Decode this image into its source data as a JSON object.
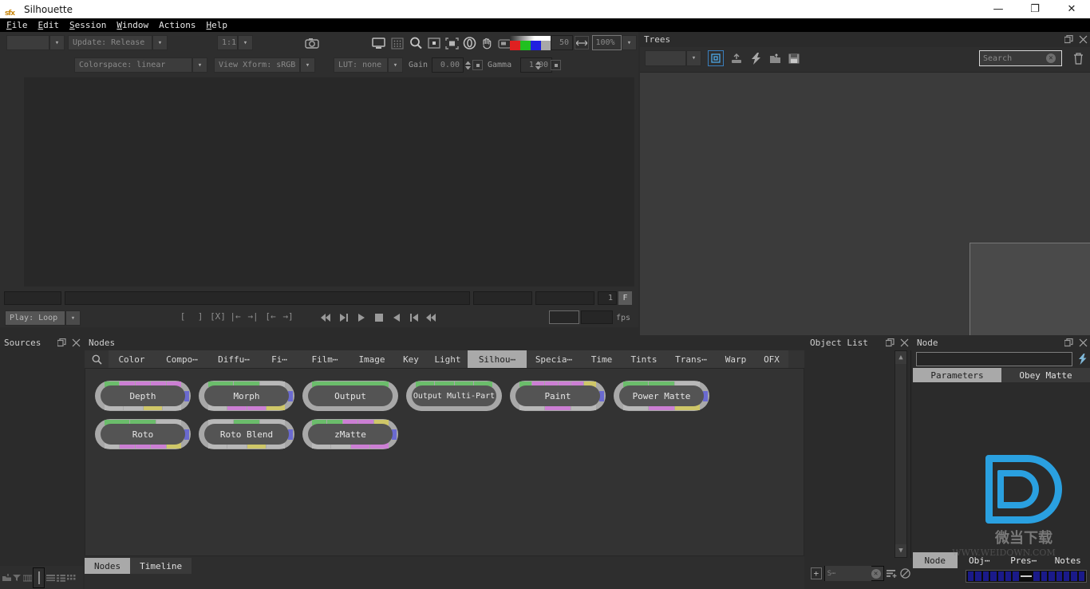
{
  "window": {
    "title": "Silhouette",
    "logo_icon": "sfx-logo-icon",
    "minimize_label": "—",
    "maximize_label": "❐",
    "close_label": "✕"
  },
  "menubar": {
    "items": [
      {
        "label": "File",
        "mnemonic": "F"
      },
      {
        "label": "Edit",
        "mnemonic": "E"
      },
      {
        "label": "Session",
        "mnemonic": "S"
      },
      {
        "label": "Window",
        "mnemonic": "W"
      },
      {
        "label": "Actions",
        "mnemonic": "A"
      },
      {
        "label": "Help",
        "mnemonic": "H"
      }
    ]
  },
  "toolbar": {
    "session_combo": "",
    "update_combo": "Update: Release",
    "ratio_combo": "1:1",
    "snapshot_icon": "camera-icon",
    "view_icons": [
      "monitor-icon",
      "grid-icon",
      "magnifier-icon",
      "frame-icon",
      "fit-icon",
      "color-wheel-icon",
      "hand-icon",
      "region-icon"
    ],
    "channel_swatch_icon": "rgba-channel-swatch",
    "brightness_value": "50",
    "fit_width_icon": "fit-width-icon",
    "zoom_value": "100%",
    "colorspace_combo": "Colorspace: linear",
    "view_xform_combo": "View Xform: sRGB",
    "lut_combo": "LUT: none",
    "gain_label": "Gain",
    "gain_value": "0.00",
    "gamma_label": "Gamma",
    "gamma_value": "1.00"
  },
  "transport": {
    "in_field": "",
    "scrub_field": "",
    "range_field_a": "",
    "range_field_b": "",
    "frame_value": "1",
    "frame_unit": "F",
    "play_mode_combo": "Play: Loop",
    "marker_buttons": [
      "[",
      "]",
      "[X]",
      "|←",
      "→|",
      "[←",
      "→]"
    ],
    "playback_icons": [
      "rewind-icon",
      "step-back-icon",
      "play-back-icon",
      "stop-icon",
      "play-forward-icon",
      "step-forward-icon",
      "fast-forward-icon"
    ],
    "fps_field_a": "",
    "fps_field_b": "",
    "fps_label": "fps"
  },
  "trees": {
    "title": "Trees",
    "float_icon": "float-panel-icon",
    "close_icon": "close-icon",
    "tree_combo": "",
    "tools": [
      {
        "icon": "new-tree-icon",
        "active": true
      },
      {
        "icon": "import-icon",
        "active": false
      },
      {
        "icon": "lightning-icon",
        "active": false
      },
      {
        "icon": "open-folder-icon",
        "active": false
      },
      {
        "icon": "save-icon",
        "active": false
      }
    ],
    "search_placeholder": "Search",
    "search_clear_icon": "clear-icon",
    "trash_icon": "trash-icon"
  },
  "sources": {
    "title": "Sources",
    "float_icon": "float-panel-icon",
    "close_icon": "close-icon",
    "footer_icons": [
      "add-source-icon",
      "filter-icon",
      "columns-icon",
      "separator-handle",
      "list-view-icon",
      "detail-view-icon",
      "thumb-view-icon"
    ]
  },
  "nodes": {
    "title": "Nodes",
    "search_icon": "search-icon",
    "tabs": [
      {
        "label": "Color",
        "active": false
      },
      {
        "label": "Compo⋯",
        "active": false
      },
      {
        "label": "Diffu⋯",
        "active": false
      },
      {
        "label": "Fi⋯",
        "active": false
      },
      {
        "label": "Film⋯",
        "active": false
      },
      {
        "label": "Image",
        "active": false
      },
      {
        "label": "Key",
        "active": false
      },
      {
        "label": "Light",
        "active": false
      },
      {
        "label": "Silhou⋯",
        "active": true
      },
      {
        "label": "Specia⋯",
        "active": false
      },
      {
        "label": "Time",
        "active": false
      },
      {
        "label": "Tints",
        "active": false
      },
      {
        "label": "Trans⋯",
        "active": false
      },
      {
        "label": "Warp",
        "active": false
      },
      {
        "label": "OFX",
        "active": false
      }
    ],
    "items": [
      {
        "label": "Depth",
        "top_ports": [
          "#6bbd6b",
          "#cc7fd4",
          "#cc7fd4",
          "#cc7fd4",
          "#cc7fd4"
        ],
        "bot_ports": [
          "#b8b8b8",
          "#b8b8b8",
          "#cfc768",
          "#b8b8b8"
        ],
        "out_port": "#6a6ad0"
      },
      {
        "label": "Morph",
        "top_ports": [
          "#6bbd6b",
          "#6bbd6b",
          "#b8b8b8"
        ],
        "bot_ports": [
          "#b8b8b8",
          "#cc7fd4",
          "#cc7fd4",
          "#cfc768"
        ],
        "out_port": "#6a6ad0"
      },
      {
        "label": "Output",
        "top_ports": [
          "#6bbd6b"
        ],
        "bot_ports": [],
        "out_port": ""
      },
      {
        "label": "Output Multi-Part",
        "top_ports": [
          "#6bbd6b",
          "#6bbd6b",
          "#6bbd6b",
          "#6bbd6b"
        ],
        "bot_ports": [],
        "out_port": ""
      },
      {
        "label": "Paint",
        "top_ports": [
          "#6bbd6b",
          "#cc7fd4",
          "#cc7fd4",
          "#cc7fd4",
          "#cc7fd4",
          "#cfc768"
        ],
        "bot_ports": [
          "#b8b8b8",
          "#cc7fd4",
          "#b8b8b8"
        ],
        "out_port": "#6a6ad0"
      },
      {
        "label": "Power Matte",
        "top_ports": [
          "#6bbd6b",
          "#6bbd6b",
          "#b8b8b8"
        ],
        "bot_ports": [
          "#b8b8b8",
          "#cc7fd4",
          "#cfc768"
        ],
        "out_port": "#6a6ad0"
      },
      {
        "label": "Roto",
        "top_ports": [
          "#6bbd6b",
          "#6bbd6b",
          "#b8b8b8"
        ],
        "bot_ports": [
          "#b8b8b8",
          "#cc7fd4",
          "#cc7fd4",
          "#cc7fd4",
          "#cfc768"
        ],
        "out_port": "#6a6ad0"
      },
      {
        "label": "Roto Blend",
        "top_ports": [
          "#b8b8b8",
          "#6bbd6b",
          "#b8b8b8"
        ],
        "bot_ports": [
          "#b8b8b8",
          "#b8b8b8",
          "#cfc768",
          "#b8b8b8"
        ],
        "out_port": "#6a6ad0"
      },
      {
        "label": "zMatte",
        "top_ports": [
          "#6bbd6b",
          "#6bbd6b",
          "#cc7fd4",
          "#cc7fd4",
          "#cfc768"
        ],
        "bot_ports": [
          "#b8b8b8",
          "#b8b8b8",
          "#cc7fd4",
          "#cc7fd4"
        ],
        "out_port": "#6a6ad0"
      }
    ],
    "bottom_tabs": [
      {
        "label": "Nodes",
        "active": true
      },
      {
        "label": "Timeline",
        "active": false
      }
    ]
  },
  "object_list": {
    "title": "Object List",
    "float_icon": "float-panel-icon",
    "close_icon": "close-icon",
    "scroll_up_icon": "chevron-up-icon",
    "scroll_down_icon": "chevron-down-icon",
    "add_label": "+",
    "search_value": "S⋯",
    "search_clear_icon": "clear-icon",
    "sort_icon": "sort-add-icon",
    "disable_icon": "no-entry-icon"
  },
  "node_panel": {
    "title": "Node",
    "float_icon": "float-panel-icon",
    "close_icon": "close-icon",
    "name_field": "",
    "lightning_icon": "lightning-icon",
    "tabs": [
      {
        "label": "Parameters",
        "active": true
      },
      {
        "label": "Obey Matte",
        "active": false
      }
    ],
    "bottom_tabs": [
      {
        "label": "Node",
        "active": true
      },
      {
        "label": "Obj⋯",
        "active": false
      },
      {
        "label": "Pres⋯",
        "active": false
      },
      {
        "label": "Notes",
        "active": false
      }
    ],
    "redacted_bar_icon": "redacted-field"
  },
  "watermark": {
    "logo_icon": "weidown-d-logo",
    "cn_text": "微当下载",
    "url_text": "WWW.WEIDOWN.COM"
  },
  "colors": {
    "accent_blue": "#2aa0e0",
    "port_green": "#6bbd6b",
    "port_magenta": "#cc7fd4",
    "port_yellow": "#cfc768",
    "port_grey": "#b8b8b8",
    "out_port_blue": "#6a6ad0",
    "panel_bg": "#2e2e2e",
    "active_tab": "#a9a9a9"
  }
}
